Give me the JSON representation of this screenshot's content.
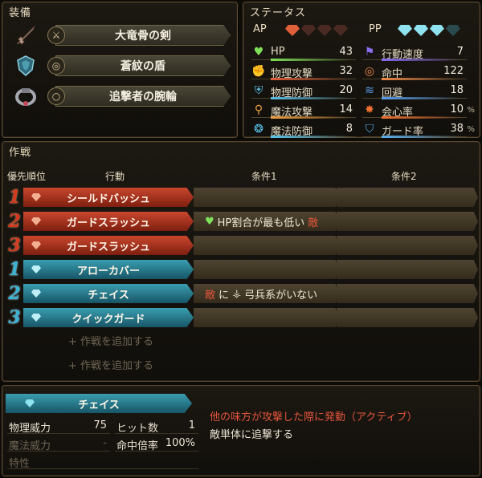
{
  "equipment": {
    "title": "装備",
    "items": [
      {
        "name": "大竜骨の剣",
        "icon": "sword-icon",
        "slot_icon": "weapon-slot-icon"
      },
      {
        "name": "蒼紋の盾",
        "icon": "shield-icon",
        "slot_icon": "shield-slot-icon"
      },
      {
        "name": "追撃者の腕輪",
        "icon": "bracelet-icon",
        "slot_icon": "accessory-slot-icon"
      }
    ]
  },
  "status": {
    "title": "ステータス",
    "ap_label": "AP",
    "ap_filled": 1,
    "ap_total": 4,
    "pp_label": "PP",
    "pp_filled": 3,
    "pp_total": 4,
    "stats": [
      {
        "name": "HP",
        "value": "43",
        "icon": "heart-icon",
        "unit": ""
      },
      {
        "name": "行動速度",
        "value": "7",
        "icon": "speed-icon",
        "unit": ""
      },
      {
        "name": "物理攻撃",
        "value": "32",
        "icon": "fist-icon",
        "unit": ""
      },
      {
        "name": "命中",
        "value": "122",
        "icon": "target-icon",
        "unit": ""
      },
      {
        "name": "物理防御",
        "value": "20",
        "icon": "armor-icon",
        "unit": ""
      },
      {
        "name": "回避",
        "value": "18",
        "icon": "evade-icon",
        "unit": ""
      },
      {
        "name": "魔法攻撃",
        "value": "14",
        "icon": "staff-icon",
        "unit": ""
      },
      {
        "name": "会心率",
        "value": "10",
        "icon": "crit-icon",
        "unit": "%"
      },
      {
        "name": "魔法防御",
        "value": "8",
        "icon": "magic-defense-icon",
        "unit": ""
      },
      {
        "name": "ガード率",
        "value": "38",
        "icon": "guard-icon",
        "unit": "%"
      }
    ]
  },
  "tactics": {
    "title": "作戦",
    "headers": {
      "priority": "優先順位",
      "action": "行動",
      "cond1": "条件1",
      "cond2": "条件2"
    },
    "rows": [
      {
        "priority": "1",
        "type": "AP",
        "action": "シールドバッシュ",
        "cond1": "",
        "cond2": ""
      },
      {
        "priority": "2",
        "type": "AP",
        "action": "ガードスラッシュ",
        "cond1": "HP割合が最も低い",
        "cond1_suffix": "敵",
        "cond2": ""
      },
      {
        "priority": "3",
        "type": "AP",
        "action": "ガードスラッシュ",
        "cond1": "",
        "cond2": ""
      },
      {
        "priority": "1",
        "type": "PP",
        "action": "アローカバー",
        "cond1": "",
        "cond2": ""
      },
      {
        "priority": "2",
        "type": "PP",
        "action": "チェイス",
        "cond1_prefix": "敵",
        "cond1": "に",
        "cond1_tail": "弓兵系がいない",
        "cond2": ""
      },
      {
        "priority": "3",
        "type": "PP",
        "action": "クイックガード",
        "cond1": "",
        "cond2": ""
      }
    ],
    "add_label_1": "+ 作戦を追加する",
    "add_label_2": "+ 作戦を追加する"
  },
  "detail": {
    "skill_name": "チェイス",
    "physical_power_label": "物理威力",
    "physical_power": "75",
    "hits_label": "ヒット数",
    "hits": "1",
    "magic_power_label": "魔法威力",
    "magic_power": "-",
    "accuracy_label": "命中倍率",
    "accuracy": "100%",
    "trait_label": "特性",
    "effect_title": "他の味方が攻撃した際に発動（アクティブ）",
    "effect_desc": "敵単体に追撃する"
  },
  "colors": {
    "ap_gem": "#e0603a",
    "ap_gem_empty": "#4a2a22",
    "pp_gem": "#8fe3ef",
    "pp_gem_empty": "#2a4a50",
    "red_action": "#c9472d",
    "blue_action": "#3a9db0",
    "enemy_text": "#e4553a"
  }
}
